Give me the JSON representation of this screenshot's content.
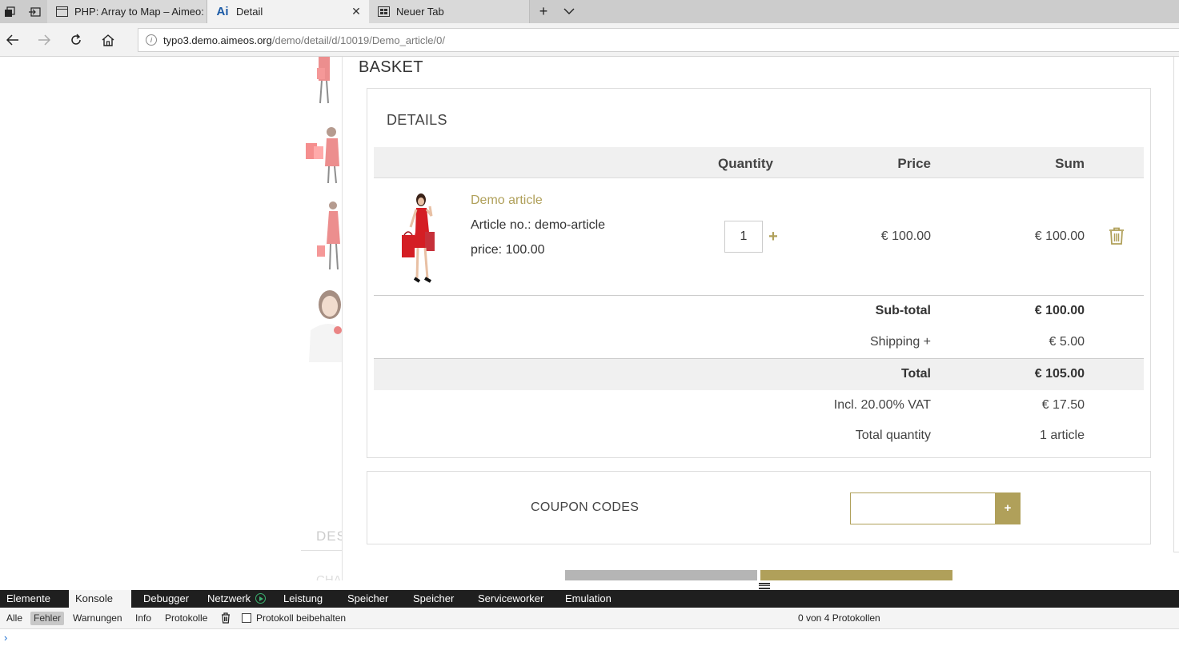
{
  "browser": {
    "tabs": [
      {
        "title": "PHP: Array to Map – Aimeo:",
        "active": false
      },
      {
        "title": "Detail",
        "active": true,
        "favicon_text": "Ai"
      },
      {
        "title": "Neuer Tab",
        "active": false
      }
    ],
    "url_host": "typo3.demo.aimeos.org",
    "url_path": "/demo/detail/d/10019/Demo_article/0/"
  },
  "page": {
    "basket_title": "BASKET",
    "details_title": "DETAILS",
    "columns": {
      "quantity": "Quantity",
      "price": "Price",
      "sum": "Sum"
    },
    "item": {
      "name": "Demo article",
      "article_no": "Article no.: demo-article",
      "price_attr": "price: 100.00",
      "quantity": "1",
      "price": "€ 100.00",
      "sum": "€ 100.00"
    },
    "summary": {
      "subtotal_label": "Sub-total",
      "subtotal_value": "€ 100.00",
      "shipping_label": "Shipping +",
      "shipping_value": "€ 5.00",
      "total_label": "Total",
      "total_value": "€ 105.00",
      "vat_label": "Incl. 20.00% VAT",
      "vat_value": "€ 17.50",
      "qty_label": "Total quantity",
      "qty_value": "1 article"
    },
    "coupon": {
      "label": "COUPON CODES",
      "button": "+",
      "placeholder": ""
    },
    "background": {
      "desc_heading": "DES",
      "char_heading": "CHA"
    }
  },
  "devtools": {
    "tabs": [
      "Elemente",
      "Konsole",
      "Debugger",
      "Netzwerk",
      "Leistung",
      "Speicher",
      "Speicher",
      "Serviceworker",
      "Emulation"
    ],
    "active_tab": "Konsole",
    "filters": [
      "Alle",
      "Fehler",
      "Warnungen",
      "Info",
      "Protokolle"
    ],
    "active_filter": "Fehler",
    "keep_log_label": "Protokoll beibehalten",
    "log_count": "0 von 4 Protokollen",
    "prompt": "›"
  },
  "colors": {
    "accent": "#b0a05a",
    "devtools_bg": "#1f1f1f"
  }
}
